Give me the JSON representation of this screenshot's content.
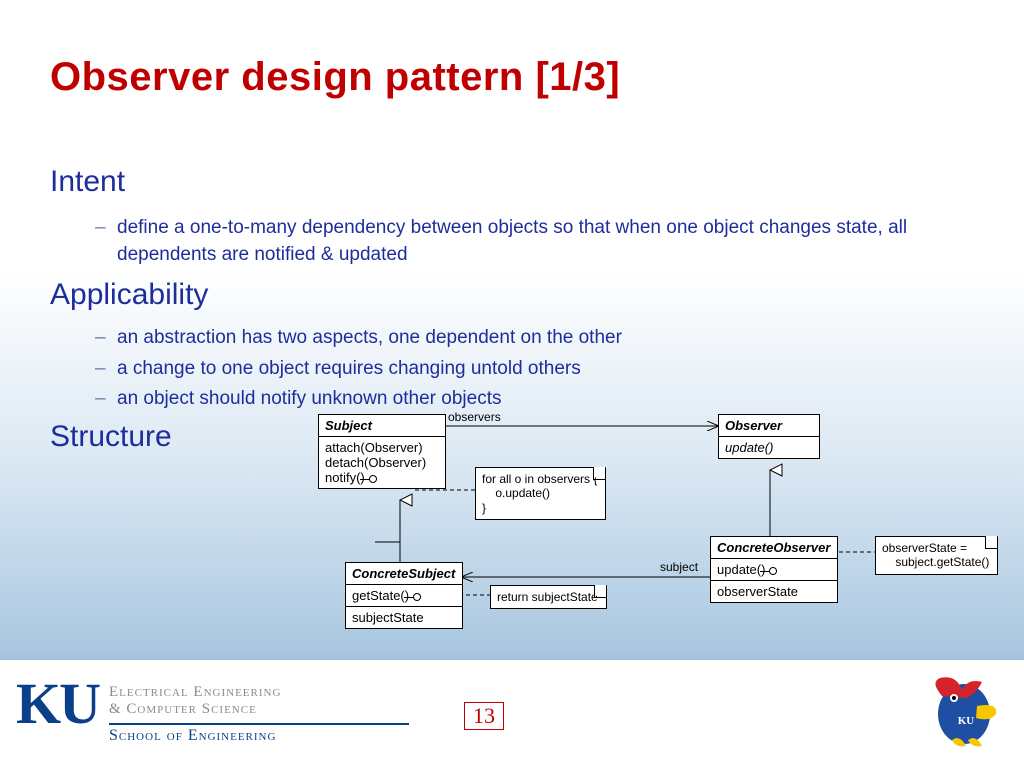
{
  "title": "Observer design pattern [1/3]",
  "sections": {
    "intent": {
      "heading": "Intent",
      "bullets": [
        "define a one-to-many dependency between objects so that when one object changes state, all dependents are notified & updated"
      ]
    },
    "applicability": {
      "heading": "Applicability",
      "bullets": [
        "an abstraction has two aspects, one dependent on the other",
        "a change to one object requires changing untold others",
        "an object should notify unknown other objects"
      ]
    },
    "structure": {
      "heading": "Structure"
    }
  },
  "uml": {
    "assoc_observers": "observers",
    "assoc_subject": "subject",
    "classes": {
      "subject": {
        "name": "Subject",
        "ops": [
          "attach(Observer)",
          "detach(Observer)",
          "notify()"
        ]
      },
      "observer": {
        "name": "Observer",
        "ops": [
          "update()"
        ]
      },
      "concreteSubject": {
        "name": "ConcreteSubject",
        "ops": [
          "getState()"
        ],
        "attrs": [
          "subjectState"
        ]
      },
      "concreteObserver": {
        "name": "ConcreteObserver",
        "ops": [
          "update()"
        ],
        "attrs": [
          "observerState"
        ]
      }
    },
    "notes": {
      "notify": "for all o in observers {\n    o.update()\n}",
      "getState": "return subjectState",
      "update": "observerState =\n    subject.getState()"
    }
  },
  "footer": {
    "ku_mark": "KU",
    "dept_line1": "Electrical Engineering",
    "dept_line2": "& Computer Science",
    "school": "School of Engineering",
    "page": "13"
  }
}
